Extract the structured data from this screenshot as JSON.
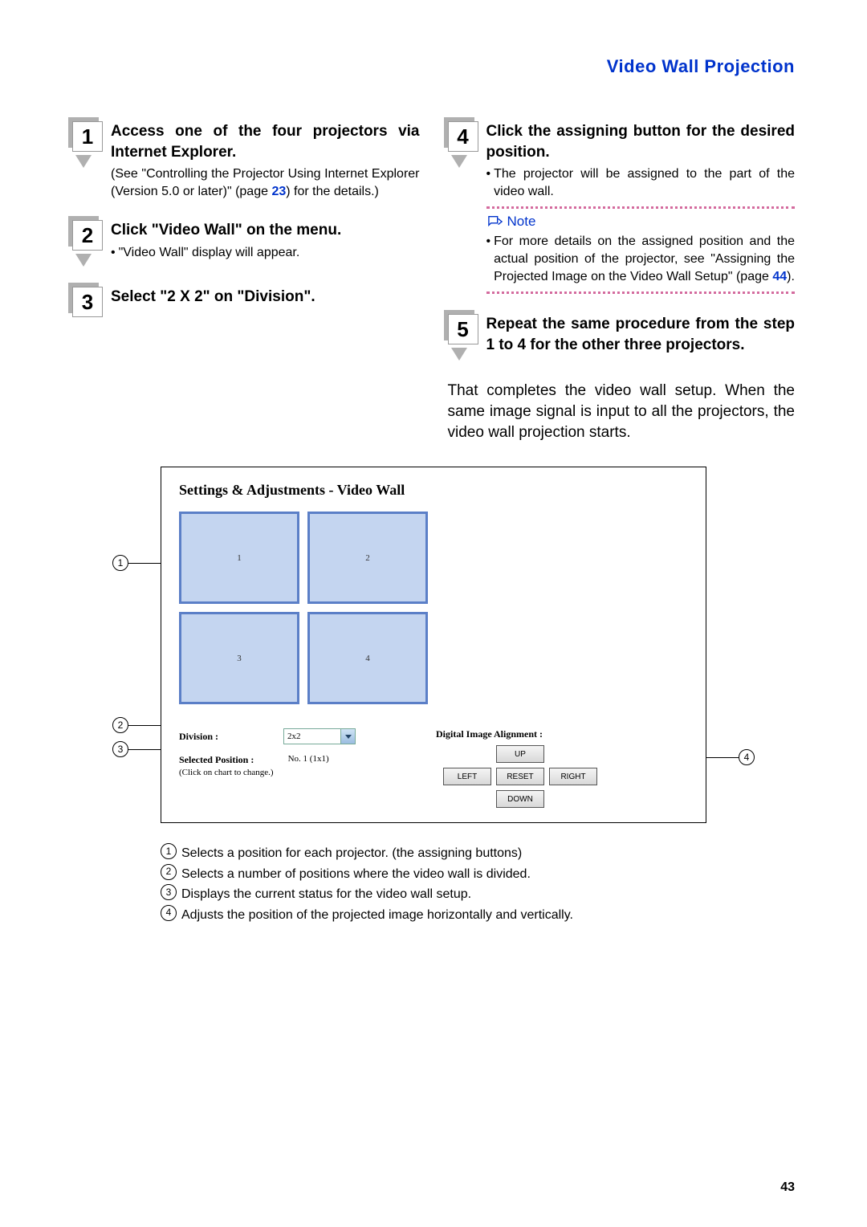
{
  "header": "Video Wall Projection",
  "page_number": "43",
  "steps_left": [
    {
      "num": "1",
      "title": "Access one of the four projectors via Internet Explorer.",
      "desc_pre": "(See \"Controlling the Projector Using Internet Explorer (Version 5.0 or later)\" (page ",
      "desc_link": "23",
      "desc_post": ") for the details.)"
    },
    {
      "num": "2",
      "title": "Click \"Video Wall\" on the menu.",
      "bullet": "\"Video Wall\" display will appear."
    },
    {
      "num": "3",
      "title": "Select \"2 X 2\" on \"Division\"."
    }
  ],
  "steps_right": [
    {
      "num": "4",
      "title": "Click the assigning button for the desired position.",
      "bullet": "The projector will be assigned to the part of the video wall.",
      "note_label": "Note",
      "note_text_pre": "For more details on the assigned position and the actual position of the projector, see \"Assigning the Projected Image on the Video Wall Setup\" (page ",
      "note_link": "44",
      "note_text_post": ")."
    },
    {
      "num": "5",
      "title": "Repeat the same procedure from the step 1 to 4 for the other three projectors."
    }
  ],
  "completion": "That completes the video wall setup. When the same image signal is input to all the projectors, the video wall projection starts.",
  "panel": {
    "title": "Settings & Adjustments - Video Wall",
    "cells": [
      "1",
      "2",
      "3",
      "4"
    ],
    "division_label": "Division :",
    "division_value": "2x2",
    "selected_label": "Selected Position :",
    "selected_value": "No. 1 (1x1)",
    "selected_hint": "(Click on chart to change.)",
    "dia_label": "Digital Image Alignment :",
    "btn_up": "UP",
    "btn_left": "LEFT",
    "btn_reset": "RESET",
    "btn_right": "RIGHT",
    "btn_down": "DOWN"
  },
  "callouts": {
    "c1": "1",
    "c2": "2",
    "c3": "3",
    "c4": "4"
  },
  "legend": {
    "l1": "Selects a position for each projector. (the assigning buttons)",
    "l2": "Selects a number of positions where the video wall is divided.",
    "l3": "Displays the current status for the video wall setup.",
    "l4": "Adjusts the position of the projected image horizontally and vertically."
  }
}
